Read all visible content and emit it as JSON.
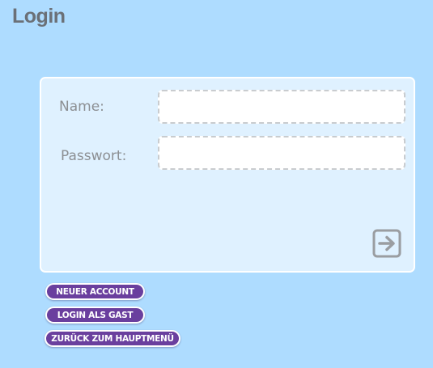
{
  "header": {
    "title": "Login"
  },
  "form": {
    "name_label": "Name:",
    "name_value": "",
    "password_label": "Passwort:",
    "password_value": "",
    "submit_icon": "arrow-right-icon"
  },
  "buttons": {
    "new_account": "NEUER ACCOUNT",
    "guest_login": "LOGIN ALS GAST",
    "back_to_menu": "ZURÜCK ZUM HAUPTMENÜ"
  },
  "colors": {
    "background": "#aedcff",
    "panel": "#dff1ff",
    "button": "#6a3f9e",
    "title": "#6b7077",
    "icon": "#9a9da1"
  }
}
